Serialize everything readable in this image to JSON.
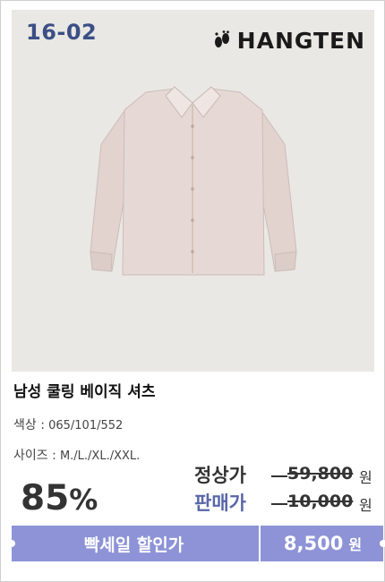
{
  "product": {
    "code": "16-02",
    "brand": "HANGTEN",
    "title": "남성 쿨링 베이직 셔츠",
    "color_label": "색상 :",
    "color_value": "065/101/552",
    "size_label": "사이즈 :",
    "size_value": "M./L./XL./XXL."
  },
  "pricing": {
    "discount_number": "85",
    "discount_symbol": "%",
    "regular_label": "정상가",
    "regular_price": "59,800",
    "sale_label": "판매가",
    "sale_price": "10,000",
    "currency": "원"
  },
  "banner": {
    "label": "빡세일 할인가",
    "final_price": "8,500",
    "currency": "원"
  },
  "colors": {
    "accent": "#8d93d6",
    "code_text": "#3b4f86",
    "sale_label": "#5866a8",
    "photo_bg": "#e9e8e4",
    "shirt": "#e4d6d2"
  },
  "icons": {
    "brand_logo": "footprints-icon"
  }
}
